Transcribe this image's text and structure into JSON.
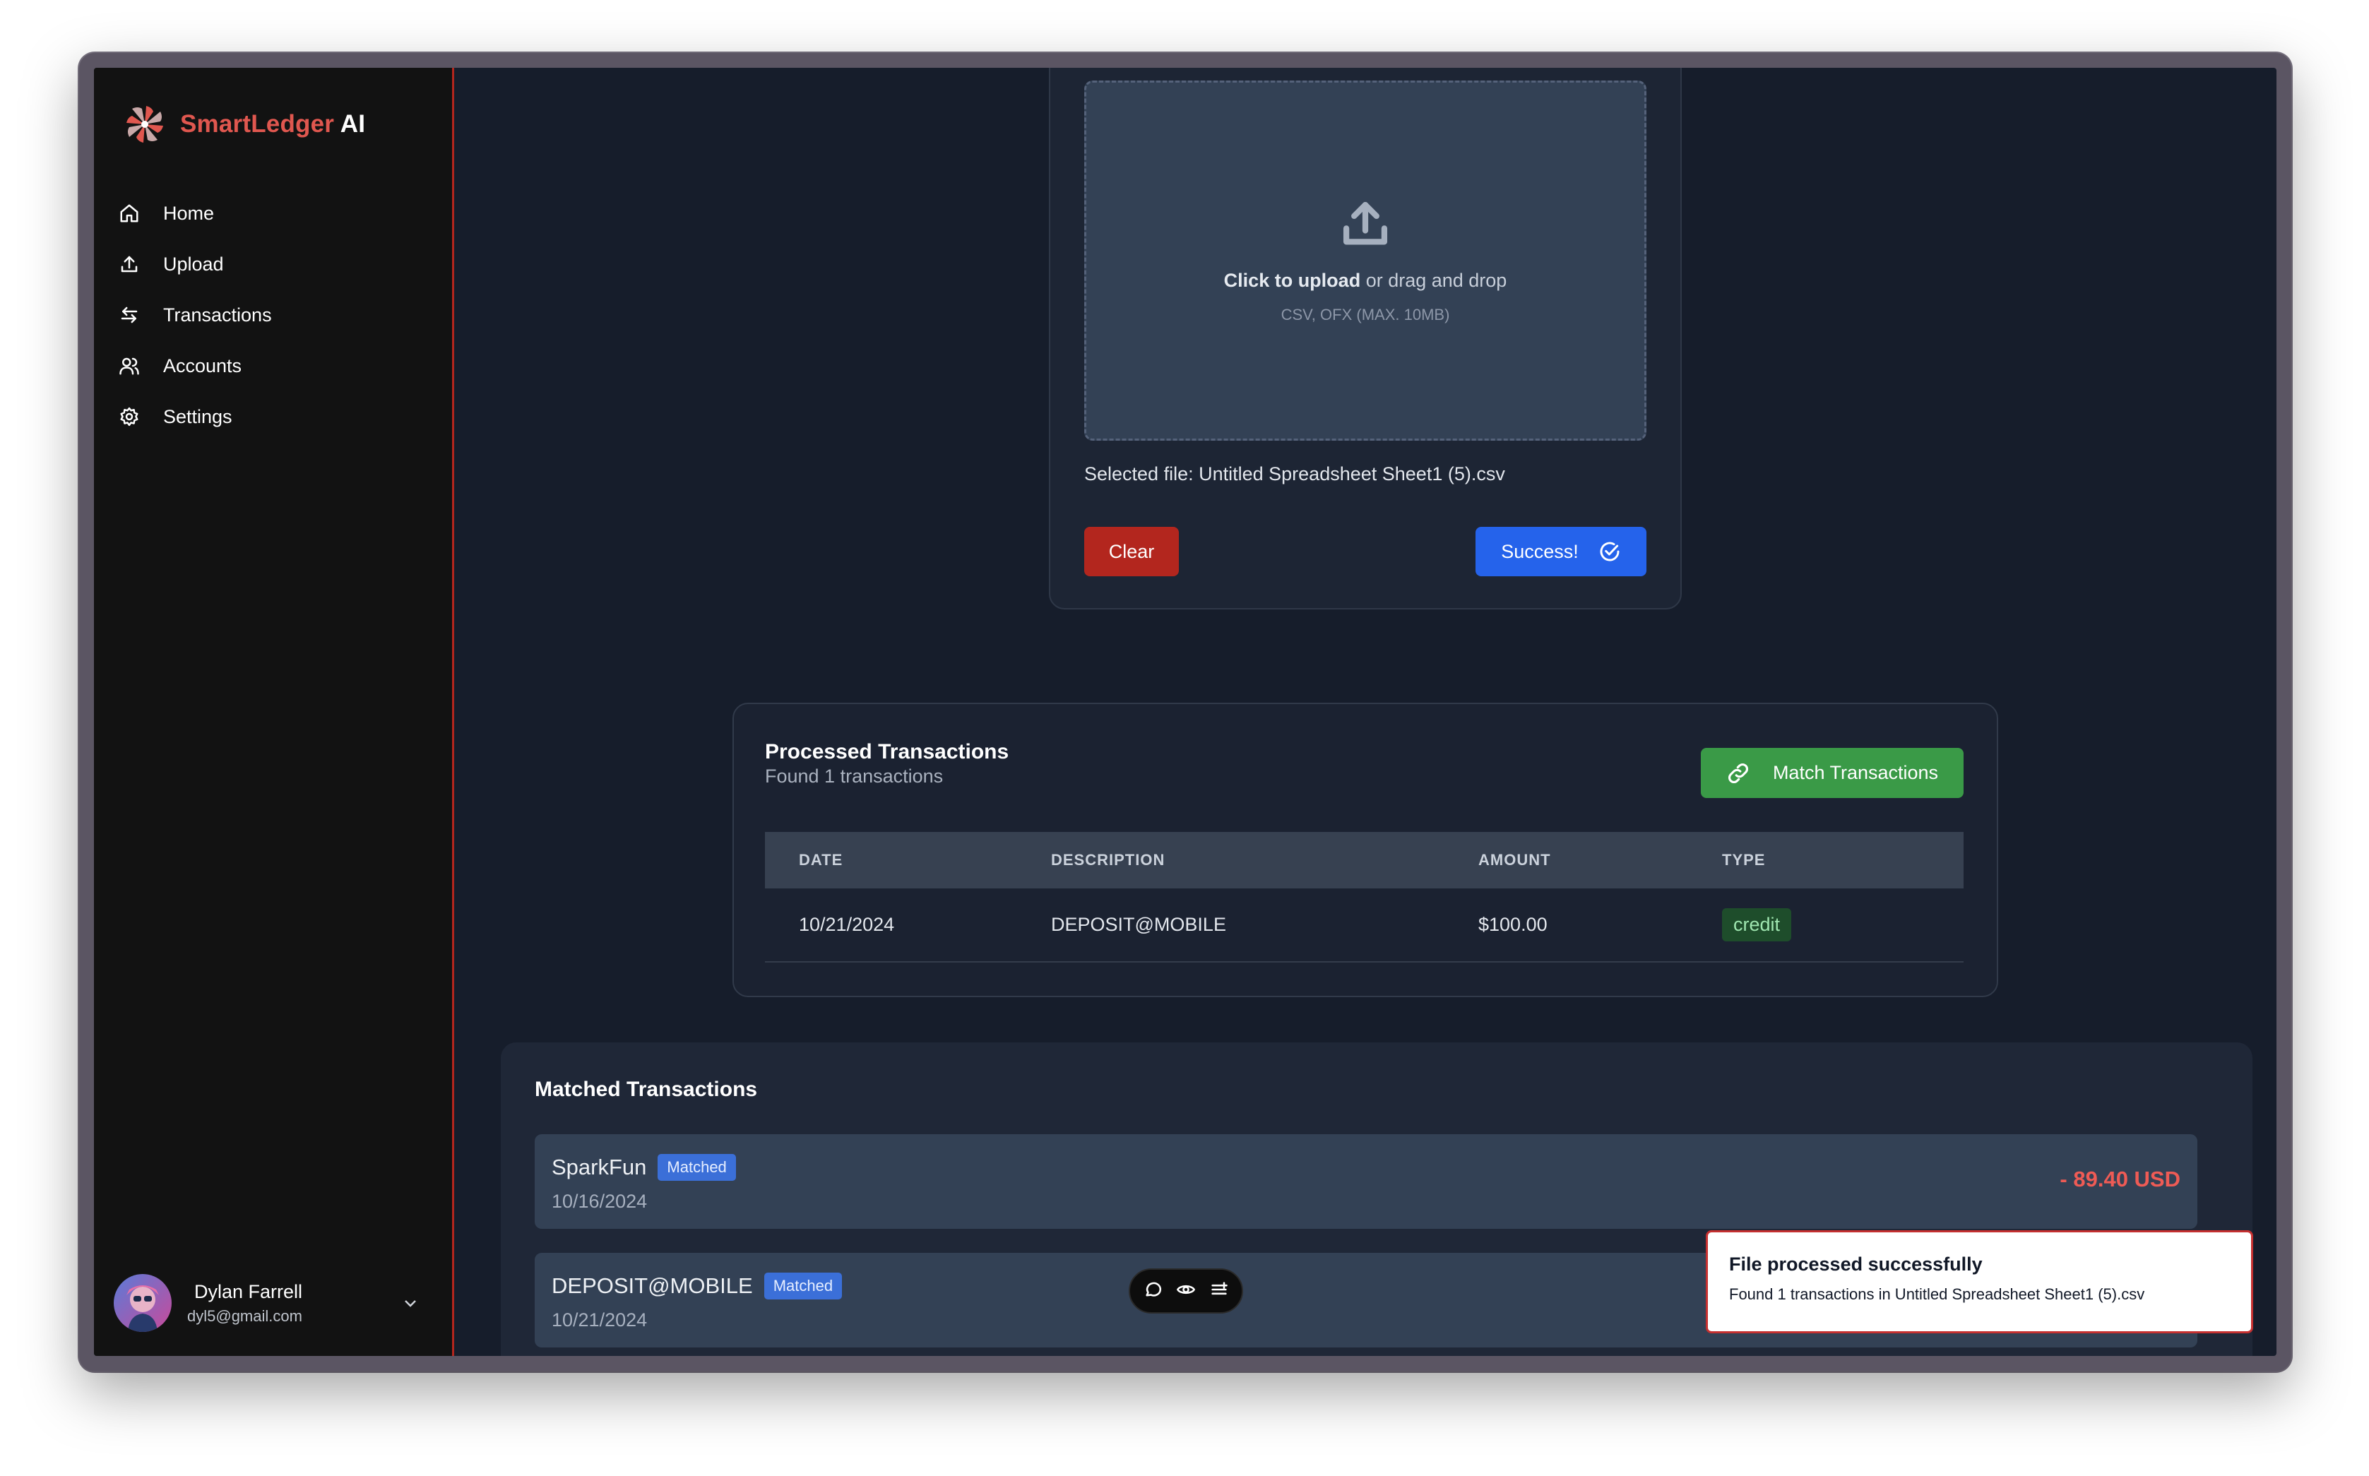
{
  "brand": {
    "name_part1": "SmartLedger",
    "name_part2": " AI"
  },
  "sidebar": {
    "items": [
      {
        "label": "Home",
        "icon": "home-icon"
      },
      {
        "label": "Upload",
        "icon": "upload-icon"
      },
      {
        "label": "Transactions",
        "icon": "transfer-icon"
      },
      {
        "label": "Accounts",
        "icon": "users-icon"
      },
      {
        "label": "Settings",
        "icon": "gear-icon"
      }
    ]
  },
  "user": {
    "name": "Dylan Farrell",
    "email": "dyl5@gmail.com"
  },
  "upload": {
    "click_text": "Click to upload",
    "drag_text": " or drag and drop",
    "hint": "CSV, OFX (MAX. 10MB)",
    "selected_file": "Selected file: Untitled Spreadsheet Sheet1 (5).csv",
    "clear_label": "Clear",
    "success_label": "Success!"
  },
  "processed": {
    "title": "Processed Transactions",
    "subtitle": "Found 1 transactions",
    "match_label": "Match Transactions",
    "columns": [
      "DATE",
      "DESCRIPTION",
      "AMOUNT",
      "TYPE"
    ],
    "rows": [
      {
        "date": "10/21/2024",
        "description": "DEPOSIT@MOBILE",
        "amount": "$100.00",
        "type": "credit"
      }
    ]
  },
  "matched": {
    "title": "Matched Transactions",
    "items": [
      {
        "name": "SparkFun",
        "badge": "Matched",
        "date": "10/16/2024",
        "amount": "- 89.40 USD"
      },
      {
        "name": "DEPOSIT@MOBILE",
        "badge": "Matched",
        "date": "10/21/2024",
        "amount": ""
      }
    ]
  },
  "toast": {
    "title": "File processed successfully",
    "message": "Found 1 transactions in Untitled Spreadsheet Sheet1 (5).csv"
  },
  "colors": {
    "sidebar_border": "#b3261e",
    "brand_accent": "#e0574f",
    "primary": "#2563eb",
    "success": "#3a9a47",
    "danger": "#b3261e",
    "negative_amount": "#ef5b55"
  }
}
